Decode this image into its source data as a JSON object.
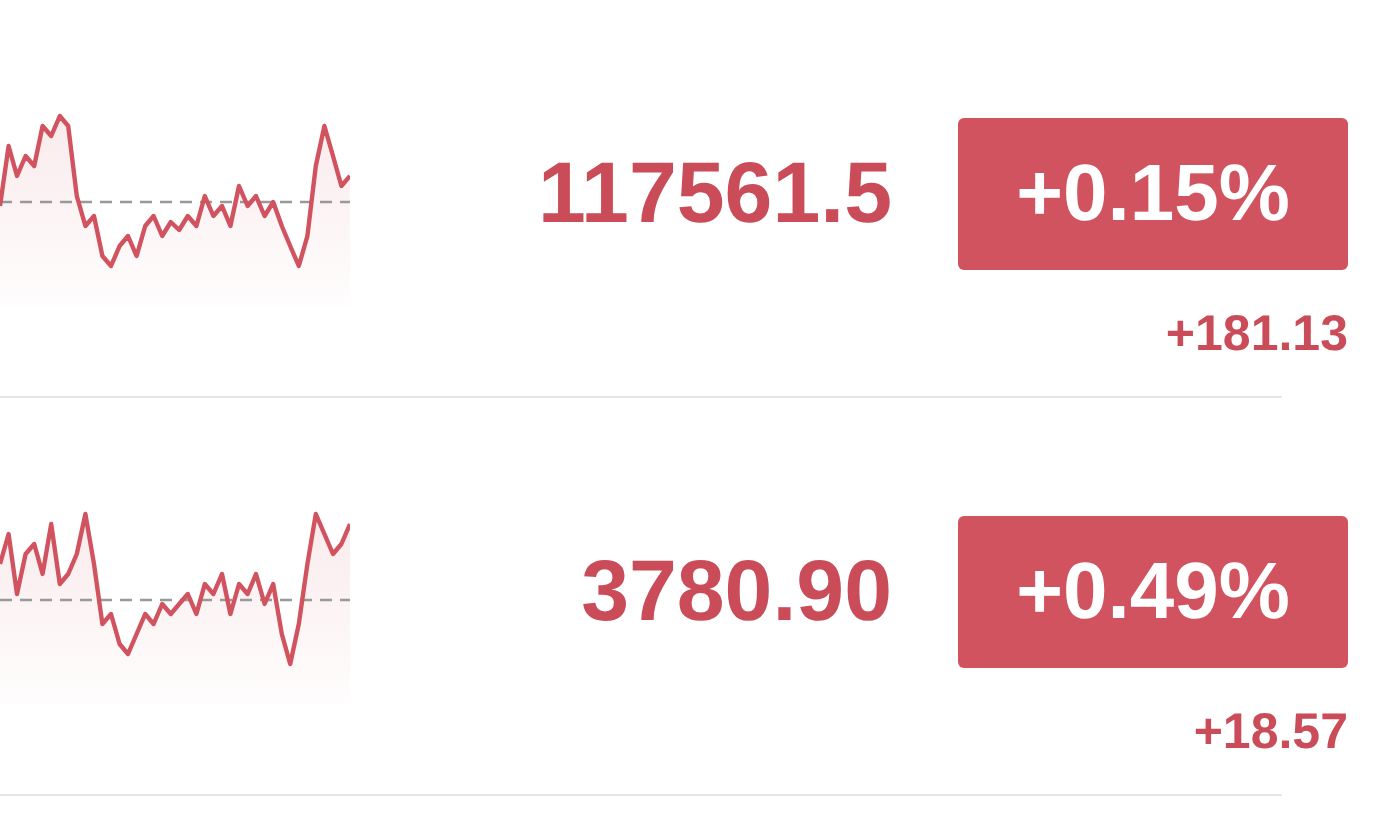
{
  "rows": [
    {
      "price": "117561.5",
      "change_percent": "+0.15%",
      "change": "+181.13"
    },
    {
      "price": "3780.90",
      "change_percent": "+0.49%",
      "change": "+18.57"
    }
  ]
}
